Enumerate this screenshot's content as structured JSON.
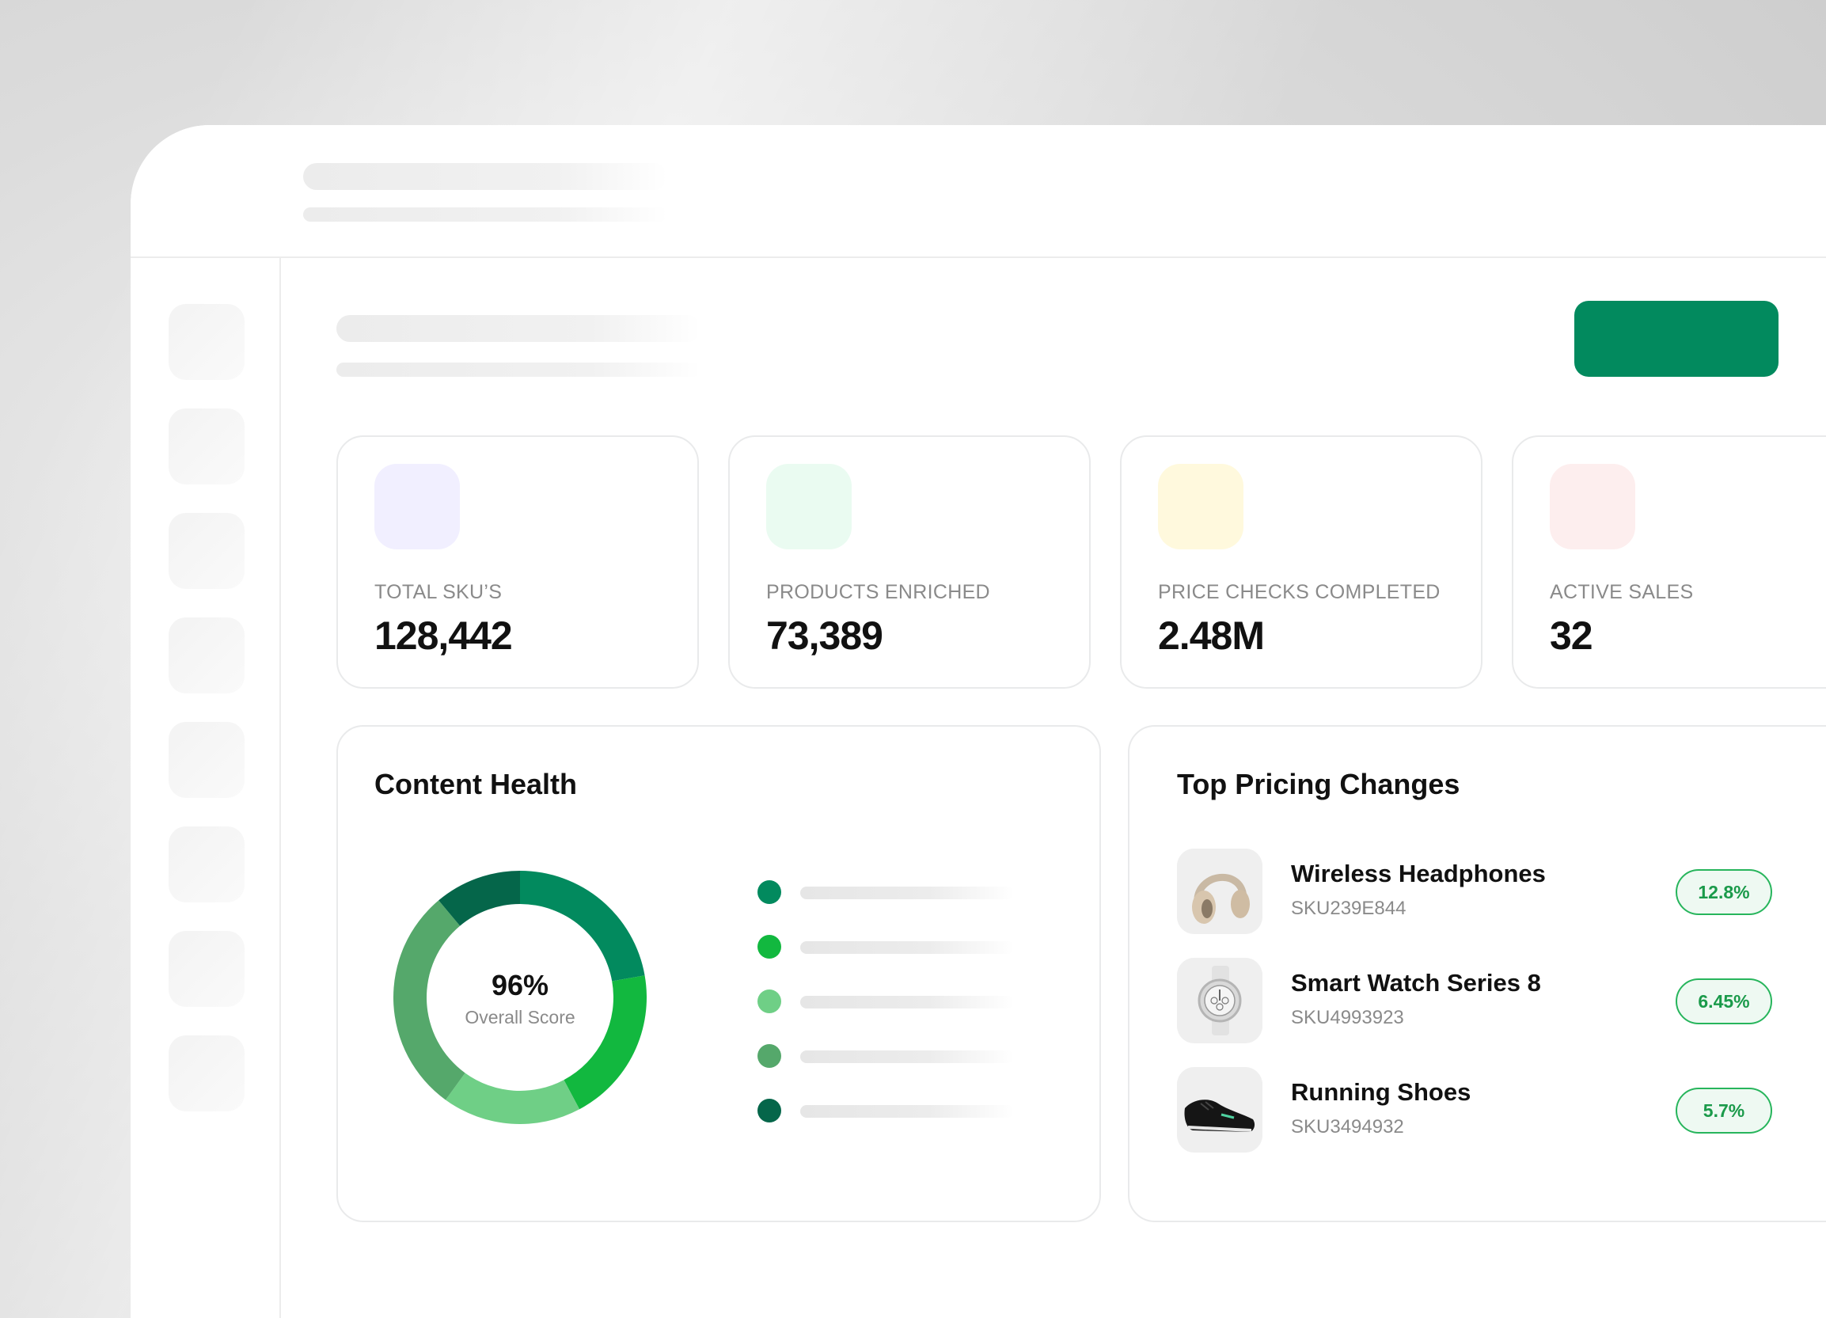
{
  "colors": {
    "primary_button": "#028a5e",
    "icon_purple": "#f1efff",
    "icon_green": "#eafbf1",
    "icon_yellow": "#fff9dd",
    "icon_red": "#fdeeee",
    "badge_green": "#1a9a4a"
  },
  "stats": [
    {
      "label": "TOTAL SKU’S",
      "value": "128,442",
      "icon": "stat-icon-purple"
    },
    {
      "label": "PRODUCTS ENRICHED",
      "value": "73,389",
      "icon": "stat-icon-green"
    },
    {
      "label": "PRICE CHECKS COMPLETED",
      "value": "2.48M",
      "icon": "stat-icon-yellow"
    },
    {
      "label": "ACTIVE SALES",
      "value": "32",
      "icon": "stat-icon-red"
    }
  ],
  "content_health": {
    "title": "Content Health",
    "score": "96%",
    "caption": "Overall Score",
    "legend_colors": [
      "#028a5e",
      "#12b83f",
      "#6fcf86",
      "#55a86b",
      "#05664a"
    ]
  },
  "chart_data": {
    "type": "pie",
    "values": [
      20,
      18,
      16,
      26,
      10
    ],
    "colors": [
      "#028a5e",
      "#12b83f",
      "#6fcf86",
      "#55a86b",
      "#05664a"
    ]
  },
  "pricing": {
    "title": "Top Pricing Changes",
    "items": [
      {
        "name": "Wireless Headphones",
        "sku": "SKU239E844",
        "change": "12.8%",
        "icon": "headphones-icon"
      },
      {
        "name": "Smart Watch Series 8",
        "sku": "SKU4993923",
        "change": "6.45%",
        "icon": "watch-icon"
      },
      {
        "name": "Running Shoes",
        "sku": "SKU3494932",
        "change": "5.7%",
        "icon": "shoe-icon"
      }
    ]
  }
}
